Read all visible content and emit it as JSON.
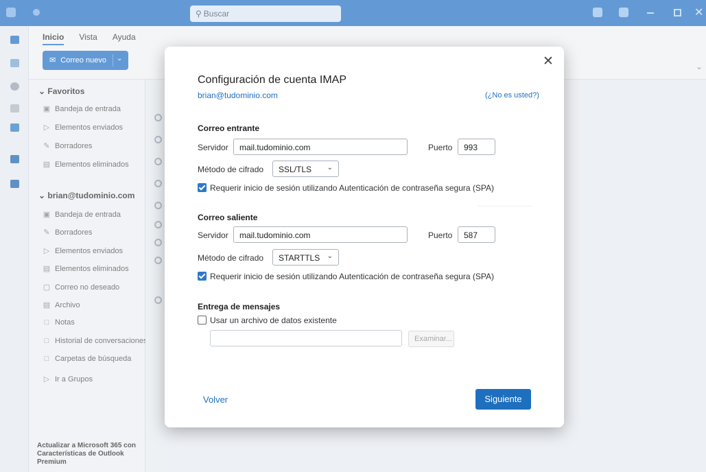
{
  "titlebar": {
    "search_placeholder": "Buscar"
  },
  "ribbon": {
    "tabs": [
      "Inicio",
      "Vista",
      "Ayuda"
    ],
    "new_mail_label": "Correo nuevo"
  },
  "folders": {
    "favorites_label": "Favoritos",
    "favorites": [
      "Bandeja de entrada",
      "Elementos enviados",
      "Borradores",
      "Elementos eliminados"
    ],
    "account_label": "brian@tudominio.com",
    "account_items": [
      "Bandeja de entrada",
      "Borradores",
      "Elementos enviados",
      "Elementos eliminados",
      "Correo no deseado",
      "Archivo",
      "Notas",
      "Historial de conversaciones",
      "Carpetas de búsqueda"
    ],
    "groups_label": "Ir a Grupos",
    "promo": "Actualizar a Microsoft 365 con Características de Outlook Premium"
  },
  "dialog": {
    "title": "Configuración de cuenta IMAP",
    "email": "brian@tudominio.com",
    "not_you": "(¿No es usted?)",
    "incoming": {
      "heading": "Correo entrante",
      "server_label": "Servidor",
      "server_value": "mail.tudominio.com",
      "port_label": "Puerto",
      "port_value": "993",
      "encryption_label": "Método de cifrado",
      "encryption_value": "SSL/TLS",
      "spa_label": "Requerir inicio de sesión utilizando Autenticación de contraseña segura (SPA)"
    },
    "outgoing": {
      "heading": "Correo saliente",
      "server_label": "Servidor",
      "server_value": "mail.tudominio.com",
      "port_label": "Puerto",
      "port_value": "587",
      "encryption_label": "Método de cifrado",
      "encryption_value": "STARTTLS",
      "spa_label": "Requerir inicio de sesión utilizando Autenticación de contraseña segura (SPA)"
    },
    "delivery": {
      "heading": "Entrega de mensajes",
      "use_existing_label": "Usar un archivo de datos existente",
      "path_value": "",
      "browse_label": "Examinar..."
    },
    "back_label": "Volver",
    "next_label": "Siguiente"
  },
  "colors": {
    "accent": "#2f78c9",
    "link": "#1f6fbf"
  }
}
